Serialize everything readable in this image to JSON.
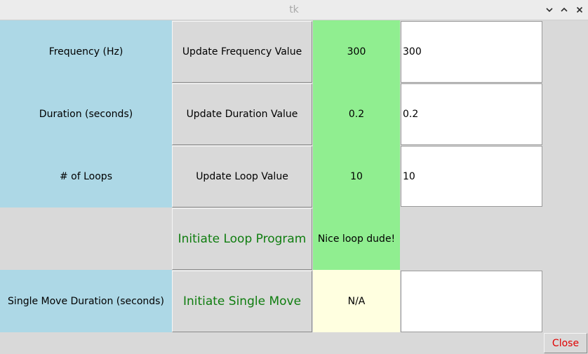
{
  "window": {
    "title": "tk",
    "controls": [
      "minimize-icon",
      "maximize-icon",
      "close-icon"
    ]
  },
  "rows": [
    {
      "label": "Frequency (Hz)",
      "button": "Update Frequency Value",
      "value": "300",
      "entry": "300"
    },
    {
      "label": "Duration (seconds)",
      "button": "Update Duration Value",
      "value": "0.2",
      "entry": "0.2"
    },
    {
      "label": "# of Loops",
      "button": "Update Loop Value",
      "value": "10",
      "entry": "10"
    },
    {
      "label": "",
      "button": "Initiate Loop Program",
      "value": "Nice loop dude!"
    },
    {
      "label": "Single Move Duration (seconds)",
      "button": "Initiate Single Move",
      "value": "N/A",
      "entry": ""
    }
  ],
  "footer": {
    "close_label": "Close"
  },
  "colors": {
    "label_bg": "#add8e6",
    "value_bg": "#90ee90",
    "na_bg": "#ffffe0",
    "action_text": "#0f7d0f",
    "close_text": "#e00000"
  }
}
